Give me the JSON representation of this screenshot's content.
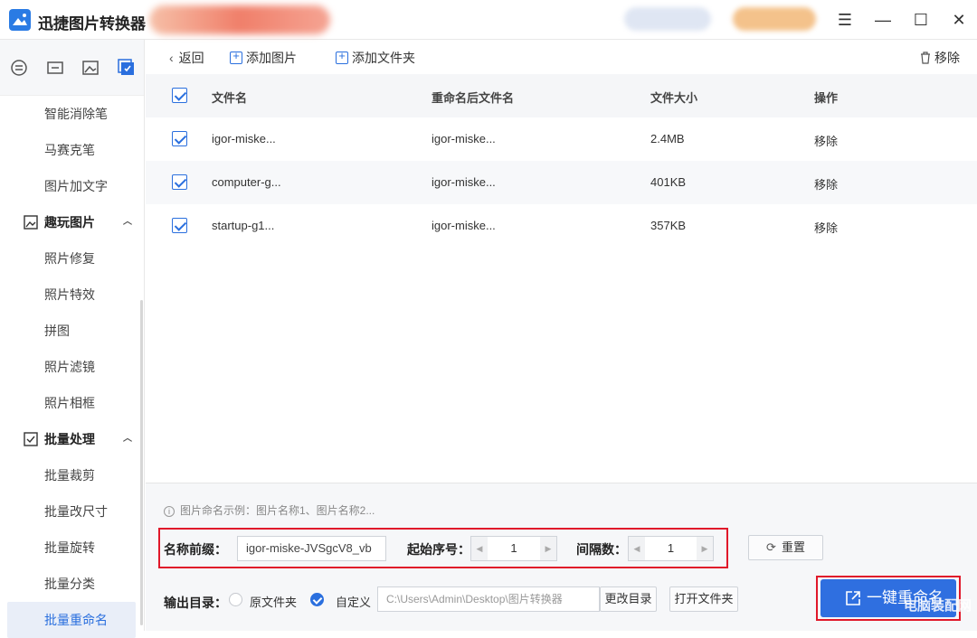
{
  "app": {
    "title": "迅捷图片转换器"
  },
  "window": {
    "minimize": "—",
    "maximize": "☐",
    "close": "✕",
    "menu": "☰"
  },
  "sidebar": {
    "items": [
      {
        "label": "智能消除笔",
        "type": "item"
      },
      {
        "label": "马赛克笔",
        "type": "item"
      },
      {
        "label": "图片加文字",
        "type": "item"
      },
      {
        "label": "趣玩图片",
        "type": "group"
      },
      {
        "label": "照片修复",
        "type": "item"
      },
      {
        "label": "照片特效",
        "type": "item"
      },
      {
        "label": "拼图",
        "type": "item"
      },
      {
        "label": "照片滤镜",
        "type": "item"
      },
      {
        "label": "照片相框",
        "type": "item"
      },
      {
        "label": "批量处理",
        "type": "group"
      },
      {
        "label": "批量裁剪",
        "type": "item"
      },
      {
        "label": "批量改尺寸",
        "type": "item"
      },
      {
        "label": "批量旋转",
        "type": "item"
      },
      {
        "label": "批量分类",
        "type": "item"
      },
      {
        "label": "批量重命名",
        "type": "item",
        "active": true
      }
    ]
  },
  "toolbar": {
    "back": "返回",
    "add_image": "添加图片",
    "add_folder": "添加文件夹",
    "remove": "移除"
  },
  "table": {
    "headers": {
      "filename": "文件名",
      "renamed": "重命名后文件名",
      "size": "文件大小",
      "action": "操作"
    },
    "rows": [
      {
        "filename": "igor-miske...",
        "renamed": "igor-miske...",
        "size": "2.4MB",
        "action": "移除"
      },
      {
        "filename": "computer-g...",
        "renamed": "igor-miske...",
        "size": "401KB",
        "action": "移除"
      },
      {
        "filename": "startup-g1...",
        "renamed": "igor-miske...",
        "size": "357KB",
        "action": "移除"
      }
    ]
  },
  "settings": {
    "hint": "图片命名示例：图片名称1、图片名称2...",
    "prefix_label": "名称前缀：",
    "prefix_value": "igor-miske-JVSgcV8_vb",
    "start_label": "起始序号：",
    "start_value": "1",
    "interval_label": "间隔数：",
    "interval_value": "1",
    "reset": "重置",
    "output_label": "输出目录：",
    "opt_original": "原文件夹",
    "opt_custom": "自定义",
    "path": "C:\\Users\\Admin\\Desktop\\图片转换器",
    "change_dir": "更改目录",
    "open_folder": "打开文件夹",
    "rename_all": "一键重命名",
    "watermark": "电脑装配网"
  }
}
